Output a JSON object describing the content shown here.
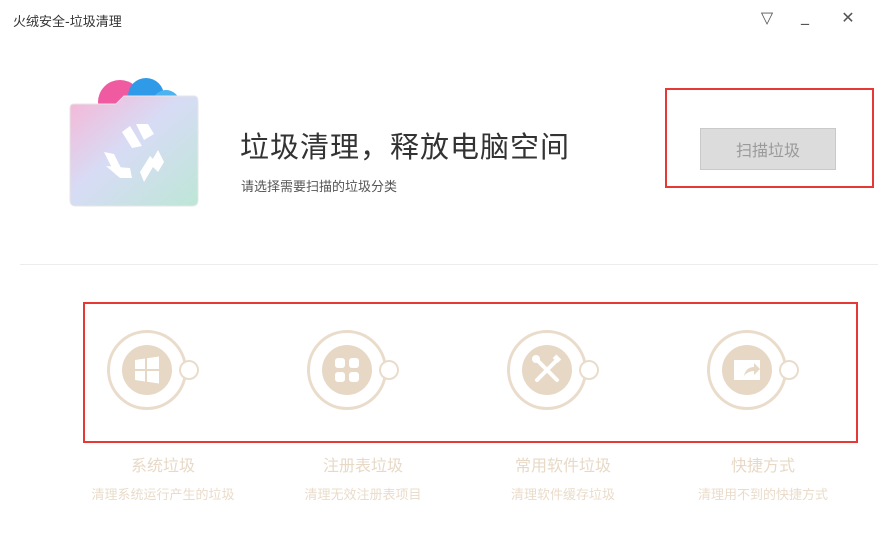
{
  "window": {
    "title": "火绒安全-垃圾清理",
    "menu_glyph": "▽",
    "minimize_glyph": "_",
    "close_glyph": "✕"
  },
  "header": {
    "headline": "垃圾清理，释放电脑空间",
    "subline": "请选择需要扫描的垃圾分类",
    "scan_button": "扫描垃圾"
  },
  "categories": [
    {
      "title": "系统垃圾",
      "desc": "清理系统运行产生的垃圾",
      "icon": "windows-icon"
    },
    {
      "title": "注册表垃圾",
      "desc": "清理无效注册表项目",
      "icon": "registry-icon"
    },
    {
      "title": "常用软件垃圾",
      "desc": "清理软件缓存垃圾",
      "icon": "tools-icon"
    },
    {
      "title": "快捷方式",
      "desc": "清理用不到的快捷方式",
      "icon": "shortcut-icon"
    }
  ],
  "colors": {
    "highlight": "#e53935",
    "category_tint": "#e7d8c6",
    "button_disabled": "#dcdcdc"
  }
}
